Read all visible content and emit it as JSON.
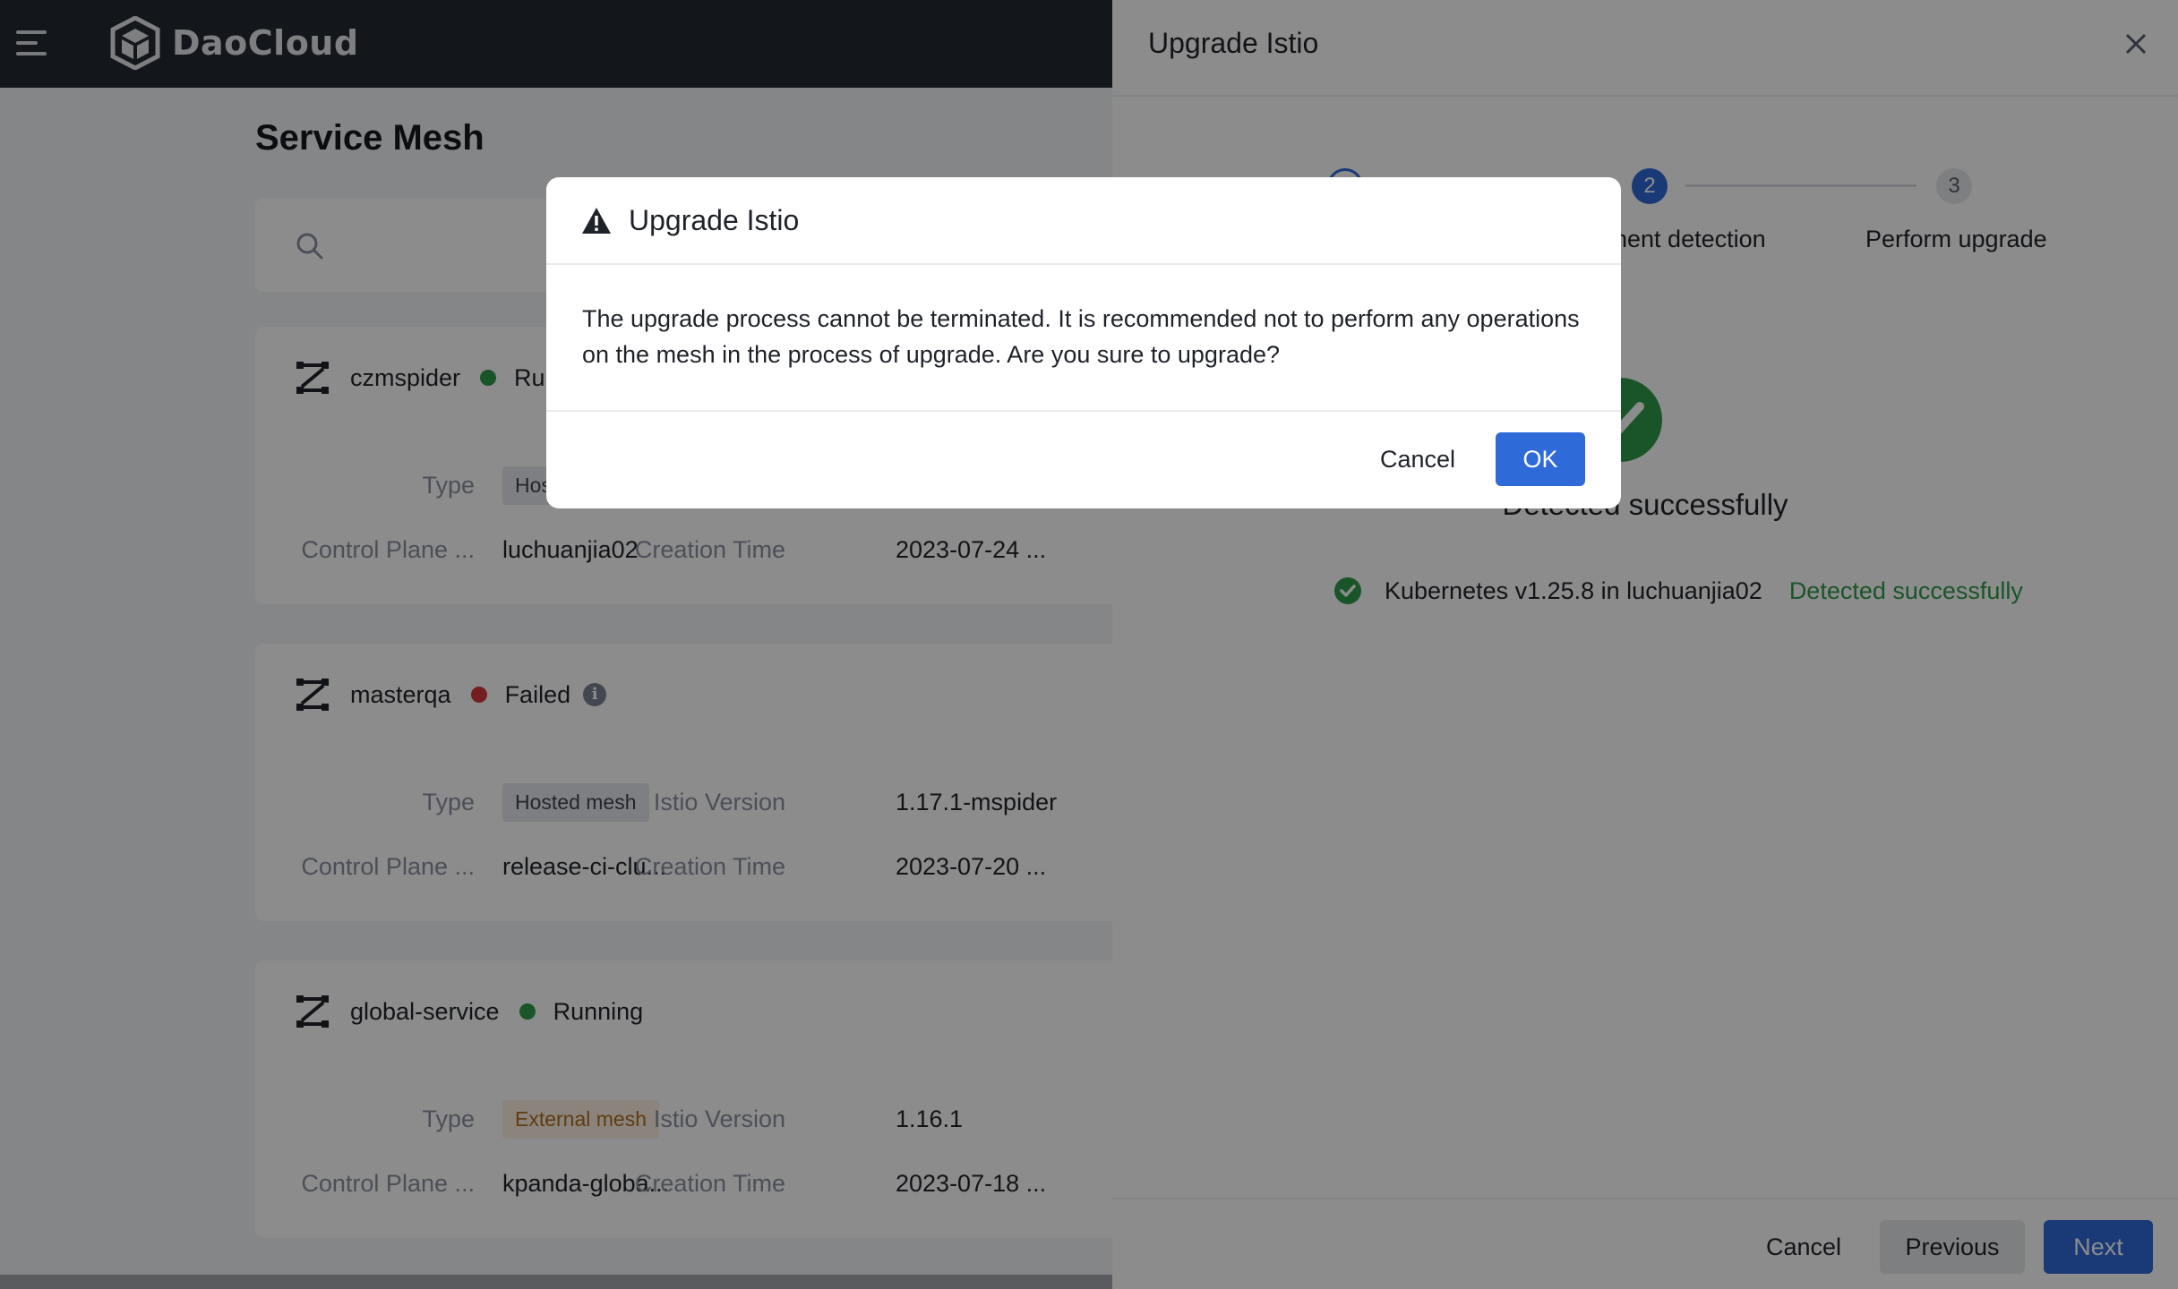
{
  "app": {
    "logo_text": "DaoCloud"
  },
  "page": {
    "title": "Service Mesh"
  },
  "meshes": [
    {
      "name": "czmspider",
      "status": "Running",
      "fields": {
        "type_label": "Type",
        "type_value": "Hosted mesh",
        "control_plane_label": "Control Plane ...",
        "control_plane_value": "luchuanjia02",
        "creation_time_label": "Creation Time",
        "creation_time_value": "2023-07-24 ..."
      }
    },
    {
      "name": "masterqa",
      "status": "Failed",
      "fields": {
        "type_label": "Type",
        "type_value": "Hosted mesh",
        "istio_version_label": "Istio Version",
        "istio_version_value": "1.17.1-mspider",
        "control_plane_label": "Control Plane ...",
        "control_plane_value": "release-ci-clu...",
        "creation_time_label": "Creation Time",
        "creation_time_value": "2023-07-20 ..."
      }
    },
    {
      "name": "global-service",
      "status": "Running",
      "fields": {
        "type_label": "Type",
        "type_value": "External mesh",
        "istio_version_label": "Istio Version",
        "istio_version_value": "1.16.1",
        "control_plane_label": "Control Plane ...",
        "control_plane_value": "kpanda-globa...",
        "creation_time_label": "Creation Time",
        "creation_time_value": "2023-07-18 ..."
      }
    }
  ],
  "drawer": {
    "title": "Upgrade Istio",
    "steps": [
      {
        "number": "1",
        "label": "",
        "state": "done"
      },
      {
        "number": "2",
        "label": "nent detection",
        "state": "active"
      },
      {
        "number": "3",
        "label": "Perform upgrade",
        "state": "todo"
      }
    ],
    "result_title": "Detected successfully",
    "detection": {
      "item": "Kubernetes v1.25.8 in luchuanjia02",
      "status": "Detected successfully"
    },
    "footer": {
      "cancel": "Cancel",
      "previous": "Previous",
      "next": "Next"
    }
  },
  "modal": {
    "title": "Upgrade Istio",
    "body": "The upgrade process cannot be terminated. It is recommended not to perform any operations on the mesh in the process of upgrade. Are you sure to upgrade?",
    "cancel": "Cancel",
    "ok": "OK"
  },
  "colors": {
    "primary": "#2f6ad9",
    "success": "#2e9b4a",
    "danger": "#d33a3a",
    "topbar": "#242a33"
  }
}
